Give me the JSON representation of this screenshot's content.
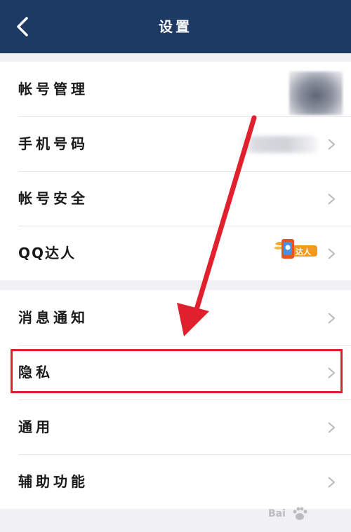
{
  "header": {
    "title": "设置"
  },
  "rows": {
    "account_manage": {
      "label": "帐号管理"
    },
    "phone_number": {
      "label": "手机号码"
    },
    "account_security": {
      "label": "帐号安全"
    },
    "qq_daren": {
      "label": "QQ达人",
      "badge_text": "达人"
    },
    "message_notify": {
      "label": "消息通知"
    },
    "privacy": {
      "label": "隐私"
    },
    "general": {
      "label": "通用"
    },
    "accessibility": {
      "label": "辅助功能"
    }
  },
  "watermark": {
    "text": "Bai",
    "logo": "baidu-paw-icon"
  },
  "colors": {
    "header_bg": "#1c3a63",
    "highlight": "#e0202c",
    "badge_orange": "#f39a1e"
  }
}
